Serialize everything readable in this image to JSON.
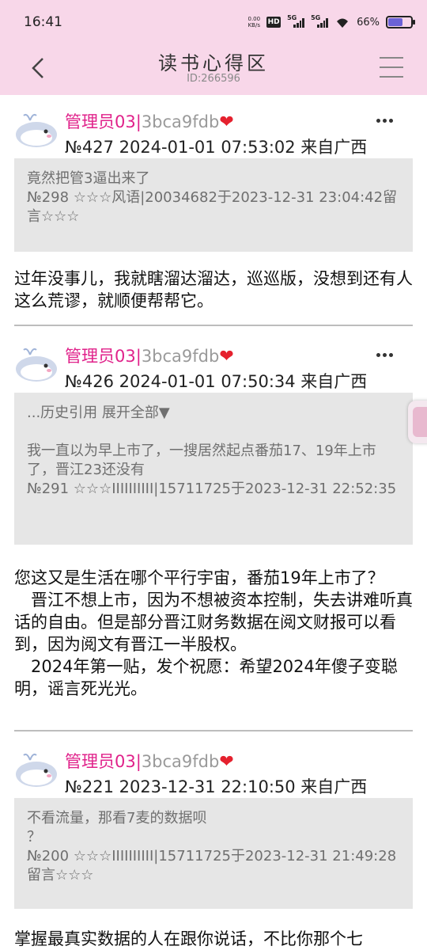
{
  "status_bar": {
    "time": "16:41",
    "net_speed_top": "0.00",
    "net_speed_bottom": "KB/s",
    "hd_label": "HD",
    "sim1_label": "5G",
    "sim2_label": "5G",
    "battery_percent": "66%",
    "battery_level": 0.66
  },
  "header": {
    "title": "读书心得区",
    "subtitle": "ID:266596"
  },
  "posts": [
    {
      "author_name": "管理员03",
      "author_sep": "|",
      "author_hash": "3bca9fdb",
      "heart": "❤",
      "meta": "№427  2024-01-01 07:53:02 来自广西",
      "quote_lines": [
        "竟然把管3逼出来了",
        "№298 ☆☆☆风语|20034682于2023-12-31 23:04:42留言☆☆☆"
      ],
      "body": "过年没事儿，我就瞎溜达溜达，巡巡版，没想到还有人这么荒谬，就顺便帮帮它。"
    },
    {
      "author_name": "管理员03",
      "author_sep": "|",
      "author_hash": "3bca9fdb",
      "heart": "❤",
      "meta": "№426  2024-01-01 07:50:34 来自广西",
      "expand_text": "...历史引用 展开全部▼",
      "quote_lines": [
        "我一直以为早上市了，一搜居然起点番茄17、19年上市了，晋江23还没有",
        "№291 ☆☆☆IIIIIIIIII|15711725于2023-12-31 22:52:35"
      ],
      "body_paragraphs": [
        "您这又是生活在哪个平行宇宙，番茄19年上市了？",
        "　晋江不想上市，因为不想被资本控制，失去讲难听真话的自由。但是部分晋江财务数据在阅文财报可以看到，因为阅文有晋江一半股权。",
        "　2024年第一贴，发个祝愿：希望2024年傻子变聪明，谣言死光光。"
      ]
    },
    {
      "author_name": "管理员03",
      "author_sep": "|",
      "author_hash": "3bca9fdb",
      "heart": "❤",
      "meta": "№221  2023-12-31 22:10:50 来自广西",
      "quote_lines": [
        "不看流量，那看7麦的数据呗",
        "？",
        "№200 ☆☆☆IIIIIIIIII|15711725于2023-12-31 21:49:28留言☆☆☆"
      ],
      "body": "掌握最真实数据的人在跟你说话，不比你那个七"
    }
  ],
  "icons": {
    "back": "back-arrow-icon",
    "menu": "menu-icon",
    "more": "more-icon",
    "avatar": "whale-avatar-icon"
  },
  "colors": {
    "header_bg": "#f8d7e9",
    "author_name": "#e0218a",
    "heart": "#e5212e",
    "quote_bg": "#e6e6e6"
  }
}
